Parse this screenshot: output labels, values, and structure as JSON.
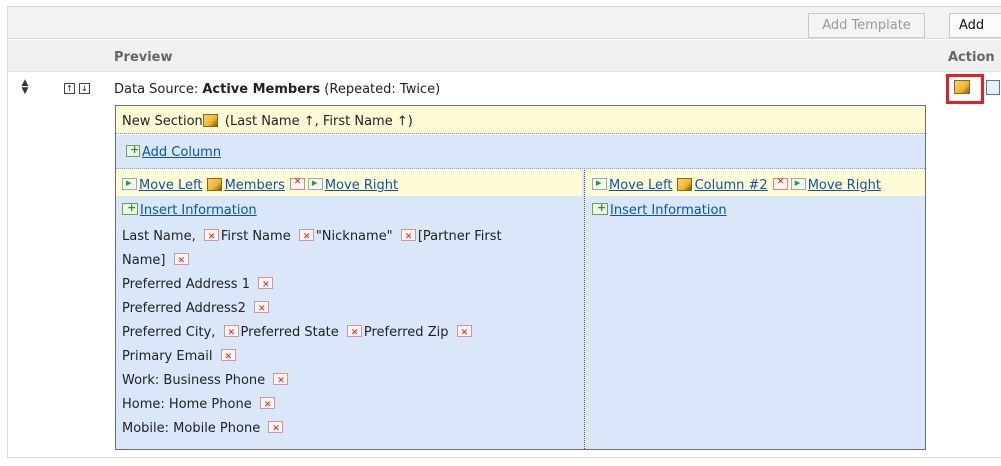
{
  "toolbar": {
    "add_template_label": "Add Template",
    "add_label": "Add"
  },
  "table_header": {
    "preview": "Preview",
    "action": "Action"
  },
  "data_source_row": {
    "prefix": "Data Source: ",
    "name": "Active Members",
    "suffix": " (Repeated: Twice)"
  },
  "section": {
    "title": "New Section",
    "sort": " (Last Name ↑, First Name ↑)",
    "add_column_label": "Add Column",
    "columns": [
      {
        "move_left": "Move Left",
        "name": "Members",
        "move_right": "Move Right",
        "insert_label": "Insert Information",
        "field_lines": [
          [
            "Last Name, ",
            "First Name ",
            "\"Nickname\" ",
            "[Partner First"
          ],
          [
            "Name] "
          ],
          [
            "Preferred Address 1 "
          ],
          [
            "Preferred Address2 "
          ],
          [
            "Preferred City, ",
            "Preferred State ",
            "Preferred Zip "
          ],
          [
            "Primary Email "
          ],
          [
            "Work: Business Phone "
          ],
          [
            "Home: Home Phone "
          ],
          [
            "Mobile: Mobile Phone "
          ]
        ]
      },
      {
        "move_left": "Move Left",
        "name": "Column #2",
        "move_right": "Move Right",
        "insert_label": "Insert Information"
      }
    ]
  },
  "icons": {
    "drag": "drag-handle-icon",
    "move_up": "move-up-icon",
    "move_down": "move-down-icon",
    "edit": "pencil-edit-icon",
    "copy": "copy-icon"
  },
  "colors": {
    "highlight_border": "#e52020",
    "section_header_bg": "#fffbd7",
    "column_bg": "#d9e7f8",
    "link": "#0b55a8"
  }
}
